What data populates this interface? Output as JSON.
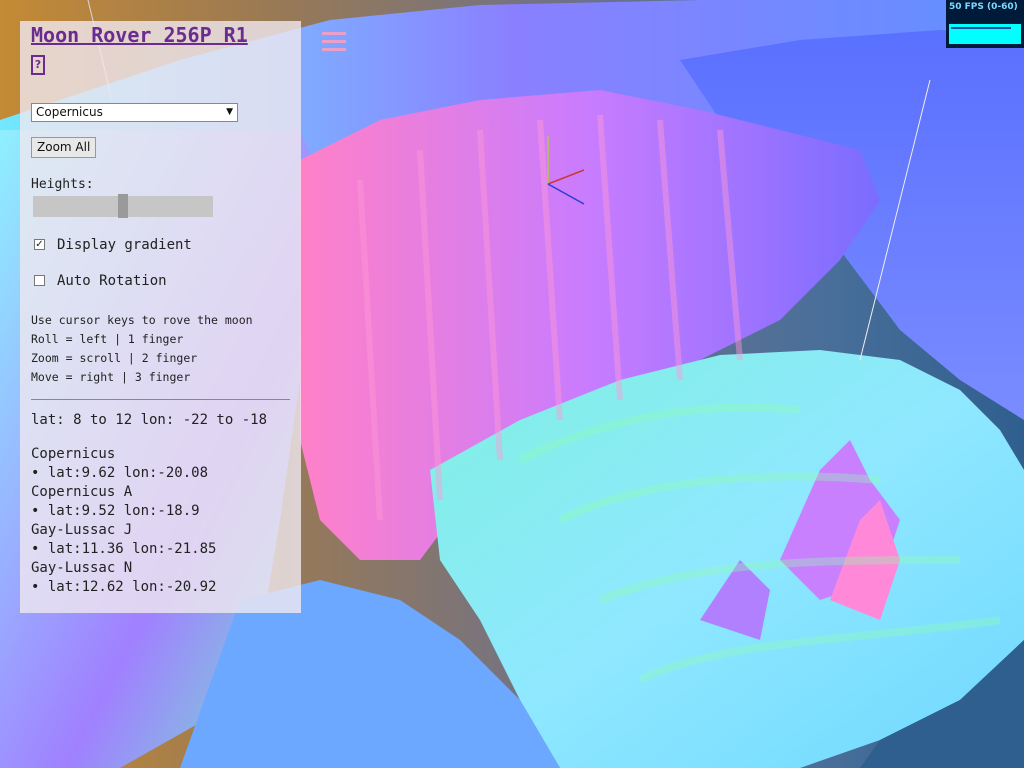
{
  "app": {
    "title": "Moon Rover 256P R1",
    "help_glyph": "?"
  },
  "stats": {
    "fps_text": "50 FPS (0-60)"
  },
  "controls": {
    "crater_select": {
      "value": "Copernicus"
    },
    "zoom_all_label": "Zoom All",
    "heights_label": "Heights:",
    "heights_slider_value": 0.5,
    "display_gradient": {
      "label": "Display gradient",
      "checked": true
    },
    "auto_rotation": {
      "label": "Auto Rotation",
      "checked": false
    }
  },
  "instructions": [
    "Use cursor keys to rove the moon",
    "Roll = left | 1 finger",
    "Zoom = scroll | 2 finger",
    "Move = right | 3 finger"
  ],
  "range_text": "lat: 8 to 12 lon: -22 to -18",
  "features": [
    {
      "name": "Copernicus",
      "coords": "• lat:9.62 lon:-20.08"
    },
    {
      "name": "Copernicus A",
      "coords": "• lat:9.52 lon:-18.9"
    },
    {
      "name": "Gay-Lussac J",
      "coords": "• lat:11.36 lon:-21.85"
    },
    {
      "name": "Gay-Lussac N",
      "coords": "• lat:12.62 lon:-20.92"
    }
  ],
  "colors": {
    "title": "#6a2c90",
    "terrain_pink": "#ff7fd0",
    "terrain_purple": "#8a6cff",
    "terrain_cyan": "#6fe8ff",
    "terrain_green": "#7dffb0",
    "terrain_blue": "#5a7cff"
  }
}
